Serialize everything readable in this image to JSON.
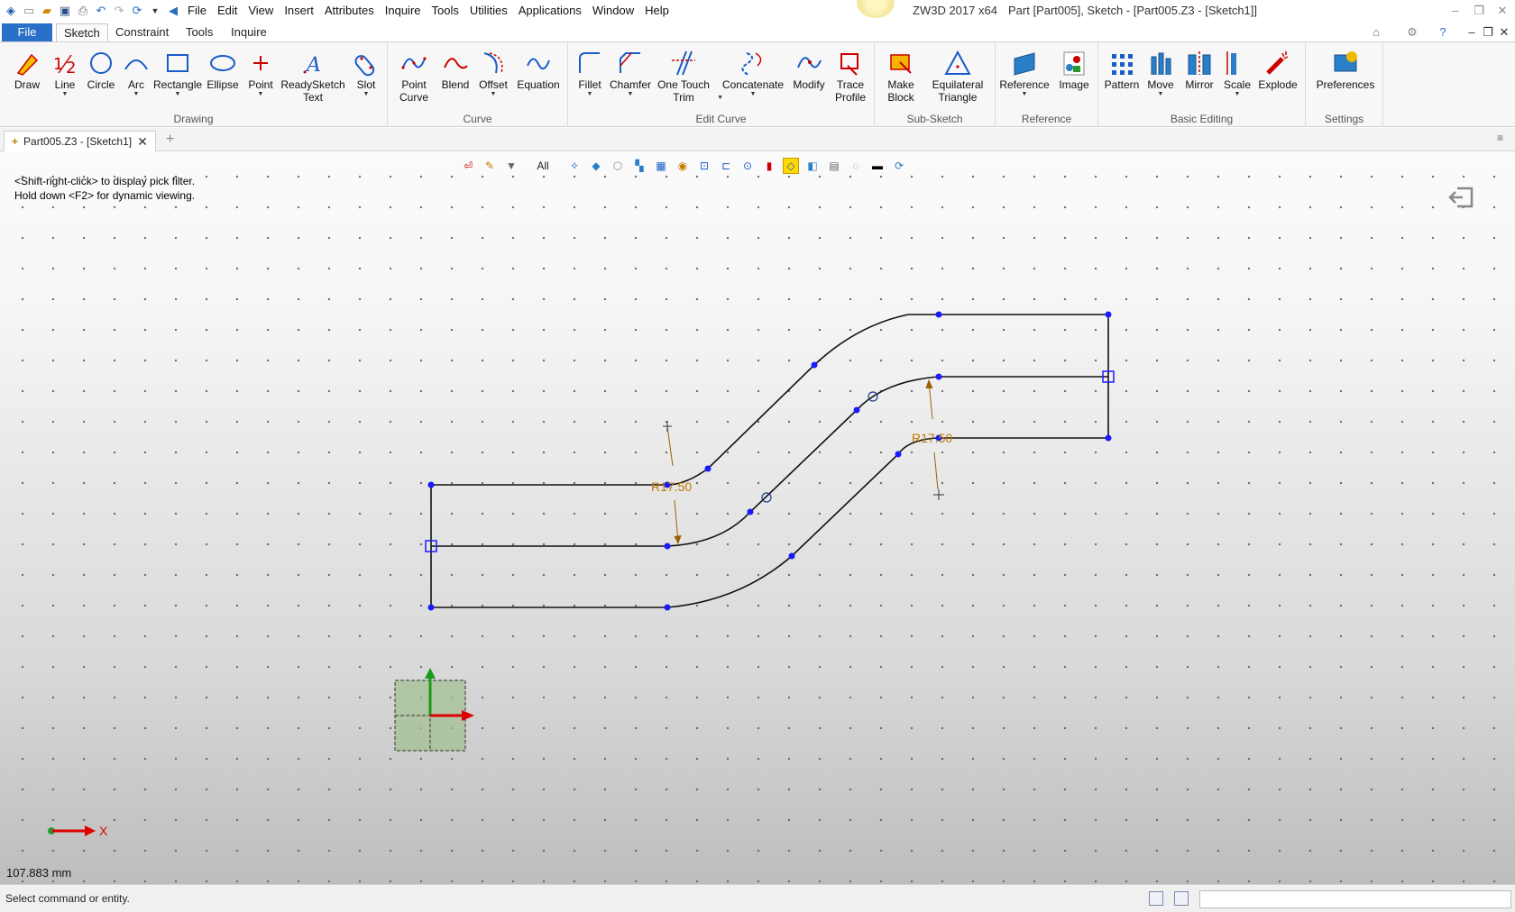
{
  "titlebar": {
    "menu": [
      "File",
      "Edit",
      "View",
      "Insert",
      "Attributes",
      "Inquire",
      "Tools",
      "Utilities",
      "Applications",
      "Window",
      "Help"
    ],
    "app_title": "ZW3D 2017  x64",
    "doc_title": "Part [Part005],  Sketch - [Part005.Z3 - [Sketch1]]"
  },
  "ribbon_tabs": [
    "File",
    "Sketch",
    "Constraint",
    "Tools",
    "Inquire"
  ],
  "ribbon": {
    "groups": [
      {
        "label": "Drawing",
        "buttons": [
          "Draw",
          "Line",
          "Circle",
          "Arc",
          "Rectangle",
          "Ellipse",
          "Point",
          "ReadySketch Text",
          "Slot"
        ]
      },
      {
        "label": "Curve",
        "buttons": [
          "Point Curve",
          "Blend",
          "Offset",
          "Equation"
        ]
      },
      {
        "label": "Edit Curve",
        "buttons": [
          "Fillet",
          "Chamfer",
          "One Touch Trim",
          "Concatenate",
          "Modify",
          "Trace Profile"
        ]
      },
      {
        "label": "Sub-Sketch",
        "buttons": [
          "Make Block",
          "Equilateral Triangle"
        ]
      },
      {
        "label": "Reference",
        "buttons": [
          "Reference",
          "Image"
        ]
      },
      {
        "label": "Basic Editing",
        "buttons": [
          "Pattern",
          "Move",
          "Mirror",
          "Scale",
          "Explode"
        ]
      },
      {
        "label": "Settings",
        "buttons": [
          "Preferences"
        ]
      }
    ]
  },
  "doc_tab": {
    "label": "Part005.Z3 - [Sketch1]"
  },
  "viewport": {
    "hint1": "<Shift-right-click> to display pick filter.",
    "hint2": "Hold down <F2> for dynamic viewing.",
    "filter_label": "All",
    "dim1": "R17.50",
    "dim2": "R17.50",
    "axis_label": "X",
    "measure": "107.883 mm"
  },
  "status": {
    "text": "Select command or entity."
  },
  "colors": {
    "accent": "#2a6fc8",
    "dimension": "#c07a00",
    "point": "#1a1aff"
  }
}
